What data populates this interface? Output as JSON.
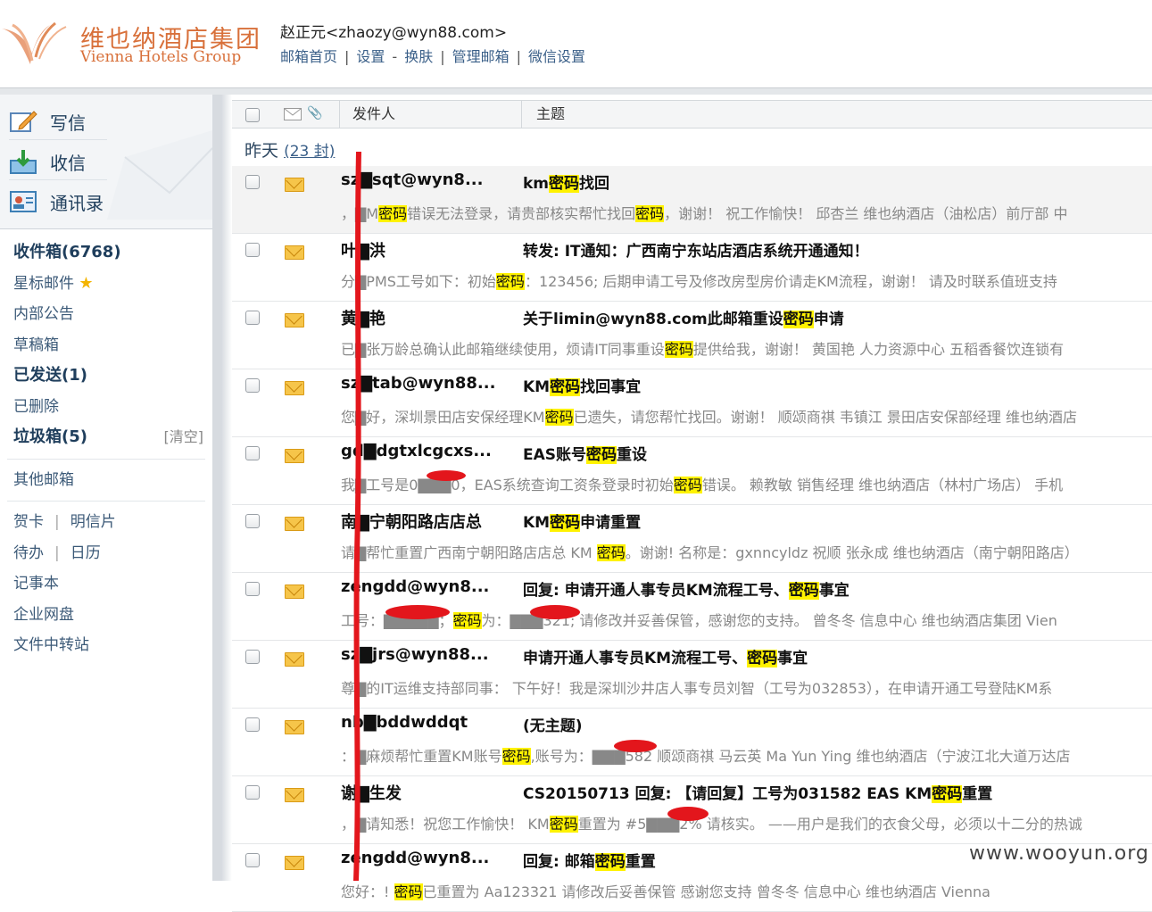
{
  "header": {
    "brand_cn": "维也纳酒店集团",
    "brand_en": "Vienna Hotels Group",
    "user": "赵正元<zhaozy@wyn88.com>",
    "links": [
      "邮箱首页",
      "设置",
      "换肤",
      "管理邮箱",
      "微信设置"
    ]
  },
  "sidebar": {
    "compose": "写信",
    "receive": "收信",
    "contacts": "通讯录",
    "folders": [
      {
        "label": "收件箱(6768)",
        "bold": true
      },
      {
        "label": "星标邮件",
        "star": true
      },
      {
        "label": "内部公告"
      },
      {
        "label": "草稿箱"
      },
      {
        "label": "已发送(1)",
        "bold": true
      },
      {
        "label": "已删除"
      },
      {
        "label": "垃圾箱(5)",
        "bold": true,
        "action": "[清空]"
      }
    ],
    "other": "其他邮箱",
    "extra": [
      "贺卡",
      "明信片",
      "待办",
      "日历",
      "记事本",
      "企业网盘",
      "文件中转站"
    ]
  },
  "list": {
    "col_sender": "发件人",
    "col_subject": "主题",
    "group_label": "昨天",
    "group_count": "(23 封)",
    "emails": [
      {
        "sender": "sz▇sqt@wyn8...",
        "subject": [
          "km",
          "密码",
          "找回"
        ],
        "preview": [
          "，▇M",
          "密码",
          "错误无法登录，请贵部核实帮忙找回",
          "密码",
          "，谢谢！ 祝工作愉快！ 邱杏兰 维也纳酒店（油松店）前厅部 中"
        ]
      },
      {
        "sender": "叶▇洪",
        "subject": [
          "转发: IT通知：广西南宁东站店酒店系统开通通知！"
        ],
        "preview": [
          "分▇PMS工号如下：初始",
          "密码",
          "：123456; 后期申请工号及修改房型房价请走KM流程，谢谢！ 请及时联系值班支持"
        ]
      },
      {
        "sender": "黄▇艳",
        "subject": [
          "关于limin@wyn88.com此邮箱重设",
          "密码",
          "申请"
        ],
        "preview": [
          "已▇张万龄总确认此邮箱继续使用，烦请IT同事重设",
          "密码",
          "提供给我，谢谢！ 黄国艳 人力资源中心 五稻香餐饮连锁有"
        ]
      },
      {
        "sender": "sz▇tab@wyn88...",
        "subject": [
          "KM",
          "密码",
          "找回事宜"
        ],
        "preview": [
          "您▇好，深圳景田店安保经理KM",
          "密码",
          "已遗失，请您帮忙找回。谢谢！ 顺颂商祺 韦镇江 景田店安保部经理 维也纳酒店"
        ]
      },
      {
        "sender": "gd▇dgtxlcgcxs...",
        "subject": [
          "EAS账号",
          "密码",
          "重设"
        ],
        "preview": [
          "我▇工号是0▇▇▇0，EAS系统查询工资条登录时初始",
          "密码",
          "错误。 赖教敏 销售经理 维也纳酒店（林村广场店） 手机"
        ]
      },
      {
        "sender": "南▇宁朝阳路店店总",
        "subject": [
          "KM",
          "密码",
          "申请重置"
        ],
        "preview": [
          "请▇帮忙重置广西南宁朝阳路店店总 KM ",
          "密码",
          "。谢谢! 名称是：gxnncyldz 祝顺 张永成 维也纳酒店（南宁朝阳路店）"
        ]
      },
      {
        "sender": "zengdd@wyn8...",
        "subject": [
          "回复: 申请开通人事专员KM流程工号、",
          "密码",
          "事宜"
        ],
        "preview": [
          "工号：▇▇▇▇▇；",
          "密码",
          "为：▇▇▇321; 请修改并妥善保管，感谢您的支持。 曾冬冬 信息中心 维也纳酒店集团 Vien"
        ]
      },
      {
        "sender": "sz▇jrs@wyn88...",
        "subject": [
          "申请开通人事专员KM流程工号、",
          "密码",
          "事宜"
        ],
        "preview": [
          "尊▇的IT运维支持部同事： 下午好！我是深圳沙井店人事专员刘智（工号为032853），在申请开通工号登陆KM系"
        ]
      },
      {
        "sender": "nb▇bddwddqt",
        "subject": [
          "(无主题)"
        ],
        "preview": [
          "：▇麻烦帮忙重置KM账号",
          "密码",
          ",账号为：▇▇▇582 顺颂商祺 马云英 Ma Yun Ying 维也纳酒店（宁波江北大道万达店"
        ]
      },
      {
        "sender": "谢▇生发",
        "subject": [
          "CS20150713 回复: 【请回复】工号为031582 EAS KM",
          "密码",
          "重置"
        ],
        "preview": [
          "，▇请知悉！祝您工作愉快！ KM",
          "密码",
          "重置为 #5▇▇▇2% 请核实。 ——用户是我们的衣食父母，必须以十二分的热诚"
        ]
      },
      {
        "sender": "zengdd@wyn8...",
        "subject": [
          "回复: 邮箱",
          "密码",
          "重置"
        ],
        "preview": [
          "您好：! ",
          "密码",
          "已重置为 Aa123321 请修改后妥善保管 感谢您支持 曾冬冬 信息中心 维也纳酒店 Vienna"
        ]
      }
    ]
  },
  "watermark": "www.wooyun.org"
}
